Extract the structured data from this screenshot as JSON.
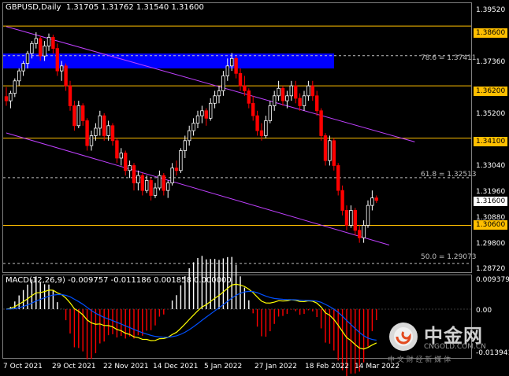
{
  "header": {
    "symbol": "GBPUSD,Daily",
    "ohlc": "1.31705 1.31762 1.31540 1.31600"
  },
  "macd_header": {
    "text": "MACD(12,26,9) -0.009757 -0.011186 0.001858 0.000000"
  },
  "price_axis": [
    "1.39520",
    "1.38640",
    "1.37360",
    "1.36480",
    "1.35200",
    "1.34320",
    "1.33040",
    "1.31960",
    "1.30880",
    "1.29800",
    "1.28720"
  ],
  "macd_axis": [
    "0.009379",
    "0.00",
    "-0.013941"
  ],
  "time_axis": [
    "7 Oct 2021",
    "29 Oct 2021",
    "22 Nov 2021",
    "14 Dec 2021",
    "5 Jan 2022",
    "27 Jan 2022",
    "18 Feb 2022",
    "14 Mar 2022"
  ],
  "level_tags": [
    "1.38600",
    "1.36200",
    "1.34100",
    "1.30600"
  ],
  "current_price_tag": "1.31600",
  "fibonacci": [
    "78.6 = 1.37411",
    "61.8 = 1.32513",
    "50.0 = 1.29073"
  ],
  "watermark": {
    "brand": "中金网",
    "domain": "CNGOLD.COM.CN",
    "tagline": "中 文 财 经 新 媒 体"
  },
  "colors": {
    "background": "#000000",
    "bull": "#ffffff",
    "bear": "#ff0000",
    "level": "#ffbf00",
    "channel": "#c040ff",
    "zone": "#0000ff",
    "macd_main": "#ffff00",
    "macd_signal": "#0050ff"
  },
  "chart_data": {
    "type": "candlestick",
    "price_range": [
      1.2872,
      1.3952
    ],
    "horizontal_levels": [
      1.386,
      1.362,
      1.341,
      1.306
    ],
    "fib_levels": [
      1.37411,
      1.32513,
      1.29073
    ],
    "supply_zone": [
      1.369,
      1.375
    ],
    "channel_upper": [
      [
        0,
        1.3858
      ],
      [
        96,
        1.3395
      ]
    ],
    "channel_lower": [
      [
        0,
        1.3431
      ],
      [
        90,
        1.2981
      ]
    ],
    "candles": [
      [
        1.3577,
        1.3615,
        1.354,
        1.356
      ],
      [
        1.356,
        1.36,
        1.353,
        1.359
      ],
      [
        1.359,
        1.365,
        1.3575,
        1.364
      ],
      [
        1.364,
        1.369,
        1.362,
        1.368
      ],
      [
        1.368,
        1.372,
        1.366,
        1.371
      ],
      [
        1.371,
        1.376,
        1.369,
        1.375
      ],
      [
        1.375,
        1.38,
        1.373,
        1.379
      ],
      [
        1.379,
        1.3835,
        1.377,
        1.381
      ],
      [
        1.381,
        1.382,
        1.372,
        1.374
      ],
      [
        1.374,
        1.38,
        1.372,
        1.378
      ],
      [
        1.378,
        1.383,
        1.376,
        1.3815
      ],
      [
        1.3815,
        1.3825,
        1.375,
        1.377
      ],
      [
        1.377,
        1.379,
        1.366,
        1.368
      ],
      [
        1.368,
        1.372,
        1.364,
        1.37
      ],
      [
        1.37,
        1.371,
        1.36,
        1.362
      ],
      [
        1.362,
        1.364,
        1.352,
        1.354
      ],
      [
        1.354,
        1.356,
        1.344,
        1.346
      ],
      [
        1.346,
        1.356,
        1.345,
        1.354
      ],
      [
        1.354,
        1.355,
        1.346,
        1.348
      ],
      [
        1.348,
        1.349,
        1.336,
        1.338
      ],
      [
        1.338,
        1.344,
        1.336,
        1.342
      ],
      [
        1.342,
        1.347,
        1.34,
        1.345
      ],
      [
        1.345,
        1.352,
        1.342,
        1.35
      ],
      [
        1.35,
        1.351,
        1.34,
        1.342
      ],
      [
        1.342,
        1.348,
        1.34,
        1.346
      ],
      [
        1.346,
        1.347,
        1.338,
        1.34
      ],
      [
        1.34,
        1.341,
        1.331,
        1.333
      ],
      [
        1.333,
        1.337,
        1.33,
        1.335
      ],
      [
        1.335,
        1.336,
        1.326,
        1.328
      ],
      [
        1.328,
        1.332,
        1.325,
        1.33
      ],
      [
        1.33,
        1.331,
        1.32,
        1.323
      ],
      [
        1.323,
        1.328,
        1.32,
        1.326
      ],
      [
        1.326,
        1.327,
        1.318,
        1.32
      ],
      [
        1.32,
        1.326,
        1.319,
        1.324
      ],
      [
        1.324,
        1.325,
        1.316,
        1.318
      ],
      [
        1.318,
        1.323,
        1.317,
        1.321
      ],
      [
        1.321,
        1.328,
        1.32,
        1.326
      ],
      [
        1.326,
        1.327,
        1.318,
        1.32
      ],
      [
        1.32,
        1.324,
        1.317,
        1.323
      ],
      [
        1.323,
        1.331,
        1.322,
        1.329
      ],
      [
        1.329,
        1.332,
        1.326,
        1.328
      ],
      [
        1.328,
        1.337,
        1.327,
        1.336
      ],
      [
        1.336,
        1.342,
        1.333,
        1.34
      ],
      [
        1.34,
        1.346,
        1.338,
        1.344
      ],
      [
        1.344,
        1.349,
        1.342,
        1.347
      ],
      [
        1.347,
        1.352,
        1.345,
        1.35
      ],
      [
        1.35,
        1.354,
        1.347,
        1.352
      ],
      [
        1.352,
        1.353,
        1.346,
        1.349
      ],
      [
        1.349,
        1.357,
        1.348,
        1.355
      ],
      [
        1.355,
        1.36,
        1.353,
        1.358
      ],
      [
        1.358,
        1.362,
        1.355,
        1.36
      ],
      [
        1.36,
        1.368,
        1.358,
        1.366
      ],
      [
        1.366,
        1.373,
        1.364,
        1.37
      ],
      [
        1.37,
        1.3752,
        1.368,
        1.373
      ],
      [
        1.373,
        1.374,
        1.365,
        1.367
      ],
      [
        1.367,
        1.369,
        1.36,
        1.362
      ],
      [
        1.362,
        1.366,
        1.358,
        1.36
      ],
      [
        1.36,
        1.361,
        1.353,
        1.355
      ],
      [
        1.355,
        1.358,
        1.348,
        1.35
      ],
      [
        1.35,
        1.352,
        1.342,
        1.344
      ],
      [
        1.344,
        1.347,
        1.34,
        1.342
      ],
      [
        1.342,
        1.35,
        1.341,
        1.348
      ],
      [
        1.348,
        1.356,
        1.347,
        1.354
      ],
      [
        1.354,
        1.36,
        1.352,
        1.358
      ],
      [
        1.358,
        1.364,
        1.356,
        1.361
      ],
      [
        1.361,
        1.362,
        1.354,
        1.356
      ],
      [
        1.356,
        1.36,
        1.353,
        1.358
      ],
      [
        1.358,
        1.364,
        1.356,
        1.362
      ],
      [
        1.362,
        1.364,
        1.355,
        1.357
      ],
      [
        1.357,
        1.359,
        1.352,
        1.354
      ],
      [
        1.354,
        1.36,
        1.352,
        1.358
      ],
      [
        1.358,
        1.364,
        1.356,
        1.362
      ],
      [
        1.362,
        1.364,
        1.356,
        1.358
      ],
      [
        1.358,
        1.36,
        1.35,
        1.352
      ],
      [
        1.352,
        1.353,
        1.34,
        1.342
      ],
      [
        1.342,
        1.343,
        1.33,
        1.332
      ],
      [
        1.332,
        1.342,
        1.33,
        1.34
      ],
      [
        1.34,
        1.341,
        1.328,
        1.33
      ],
      [
        1.33,
        1.331,
        1.318,
        1.32
      ],
      [
        1.32,
        1.322,
        1.31,
        1.312
      ],
      [
        1.312,
        1.314,
        1.304,
        1.306
      ],
      [
        1.306,
        1.314,
        1.305,
        1.312
      ],
      [
        1.312,
        1.313,
        1.302,
        1.304
      ],
      [
        1.304,
        1.306,
        1.299,
        1.301
      ],
      [
        1.301,
        1.308,
        1.299,
        1.306
      ],
      [
        1.306,
        1.316,
        1.305,
        1.314
      ],
      [
        1.314,
        1.32,
        1.312,
        1.317
      ],
      [
        1.317,
        1.318,
        1.315,
        1.316
      ]
    ],
    "macd_range": [
      -0.013941,
      0.009379
    ],
    "macd_hist_bars": 88
  }
}
